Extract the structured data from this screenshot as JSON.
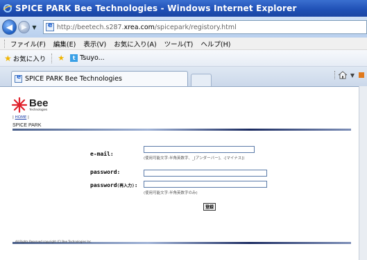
{
  "window": {
    "title": "SPICE PARK Bee Technologies - Windows Internet Explorer"
  },
  "address_bar": {
    "url_prefix": "http://beetech.s287.",
    "url_host": "xrea.com",
    "url_suffix": "/spicepark/registory.html"
  },
  "menu": {
    "items": [
      "ファイル(F)",
      "編集(E)",
      "表示(V)",
      "お気に入り(A)",
      "ツール(T)",
      "ヘルプ(H)"
    ]
  },
  "favorites_bar": {
    "favorites_label": "お気に入り",
    "site_label": "Tsuyo..."
  },
  "tab": {
    "title": "SPICE PARK Bee Technologies"
  },
  "page": {
    "logo_main": "Bee",
    "logo_sub": "Technologies",
    "home_link": "HOME",
    "section_title": "SPICE PARK",
    "email_label": "e-mail:",
    "email_hint": "(使用可能文字:半角英数字、_[アンダーバー]、-[マイナス])",
    "password_label": "password:",
    "password_confirm_label": "password",
    "password_confirm_suffix": "(再入力)",
    "password_confirm_colon": ":",
    "password_hint": "(使用可能文字:半角英数字のみ)",
    "submit_label": "登録",
    "footer": "All Rights Reserved copyright (C) Bee Technologies Inc."
  },
  "colors": {
    "titlebar": "#1f4fb4",
    "logo_red": "#e0202a"
  }
}
